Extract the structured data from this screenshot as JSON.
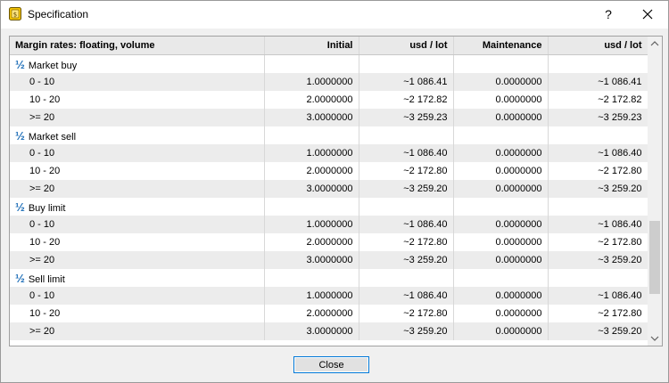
{
  "window": {
    "title": "Specification",
    "help": "?"
  },
  "table": {
    "headers": [
      "Margin rates: floating, volume",
      "Initial",
      "usd / lot",
      "Maintenance",
      "usd / lot"
    ],
    "groups": [
      {
        "label": "Market buy",
        "rows": [
          [
            "0 - 10",
            "1.0000000",
            "~1 086.41",
            "0.0000000",
            "~1 086.41"
          ],
          [
            "10 - 20",
            "2.0000000",
            "~2 172.82",
            "0.0000000",
            "~2 172.82"
          ],
          [
            ">= 20",
            "3.0000000",
            "~3 259.23",
            "0.0000000",
            "~3 259.23"
          ]
        ]
      },
      {
        "label": "Market sell",
        "rows": [
          [
            "0 - 10",
            "1.0000000",
            "~1 086.40",
            "0.0000000",
            "~1 086.40"
          ],
          [
            "10 - 20",
            "2.0000000",
            "~2 172.80",
            "0.0000000",
            "~2 172.80"
          ],
          [
            ">= 20",
            "3.0000000",
            "~3 259.20",
            "0.0000000",
            "~3 259.20"
          ]
        ]
      },
      {
        "label": "Buy limit",
        "rows": [
          [
            "0 - 10",
            "1.0000000",
            "~1 086.40",
            "0.0000000",
            "~1 086.40"
          ],
          [
            "10 - 20",
            "2.0000000",
            "~2 172.80",
            "0.0000000",
            "~2 172.80"
          ],
          [
            ">= 20",
            "3.0000000",
            "~3 259.20",
            "0.0000000",
            "~3 259.20"
          ]
        ]
      },
      {
        "label": "Sell limit",
        "rows": [
          [
            "0 - 10",
            "1.0000000",
            "~1 086.40",
            "0.0000000",
            "~1 086.40"
          ],
          [
            "10 - 20",
            "2.0000000",
            "~2 172.80",
            "0.0000000",
            "~2 172.80"
          ],
          [
            ">= 20",
            "3.0000000",
            "~3 259.20",
            "0.0000000",
            "~3 259.20"
          ]
        ]
      }
    ]
  },
  "footer": {
    "close_label": "Close"
  },
  "colors": {
    "accent": "#0078d7",
    "group_icon": "#1f6fb8",
    "app_icon": "#f5c400"
  },
  "icons": {
    "app": "specification-app-icon",
    "group": "half-fraction-icon",
    "close": "close-icon"
  }
}
